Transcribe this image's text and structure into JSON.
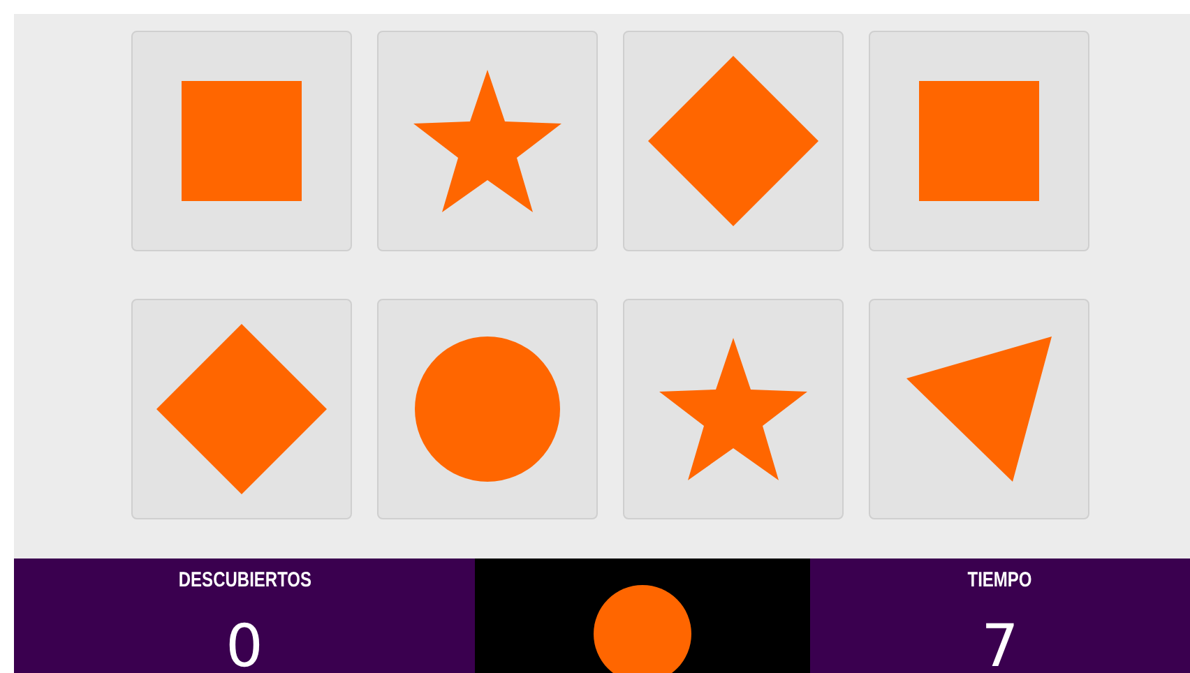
{
  "cards": [
    {
      "kind": "square"
    },
    {
      "kind": "star"
    },
    {
      "kind": "diamond"
    },
    {
      "kind": "square"
    },
    {
      "kind": "diamond"
    },
    {
      "kind": "circle"
    },
    {
      "kind": "star"
    },
    {
      "kind": "triangle"
    }
  ],
  "score": {
    "label": "DESCUBIERTOS",
    "value": "0"
  },
  "target": {
    "kind": "circle"
  },
  "timer": {
    "label": "TIEMPO",
    "value": "7"
  }
}
